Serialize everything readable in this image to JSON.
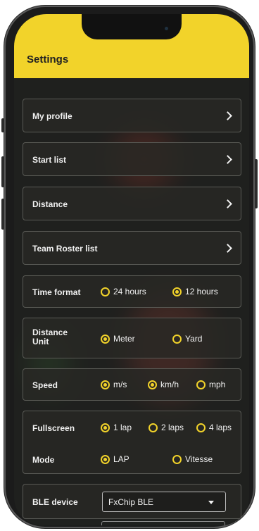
{
  "header": {
    "title": "Settings"
  },
  "nav_items": [
    {
      "label": "My profile"
    },
    {
      "label": "Start list"
    },
    {
      "label": "Distance"
    },
    {
      "label": "Team Roster list"
    }
  ],
  "time_format": {
    "label": "Time format",
    "options": [
      "24 hours",
      "12 hours"
    ],
    "selected": "12 hours"
  },
  "distance_unit": {
    "label": "Distance Unit",
    "options": [
      "Meter",
      "Yard"
    ],
    "selected": "Meter"
  },
  "speed": {
    "label": "Speed",
    "options": [
      "m/s",
      "km/h",
      "mph"
    ],
    "selected": [
      "m/s",
      "km/h"
    ]
  },
  "fullscreen": {
    "label": "Fullscreen",
    "options": [
      "1 lap",
      "2 laps",
      "4 laps"
    ],
    "selected": "1 lap"
  },
  "mode": {
    "label": "Mode",
    "options": [
      "LAP",
      "Vitesse"
    ],
    "selected": "LAP"
  },
  "ble_device": {
    "label": "BLE device",
    "value": "FxChip BLE"
  },
  "colors": {
    "accent": "#f2d32a",
    "background": "#1f201e",
    "card_border": "#595a55",
    "text": "#f1f1f1"
  },
  "icons": {
    "nav_arrow": "chevron-right-icon",
    "dropdown": "chevron-down-icon",
    "radio": "radio-icon"
  }
}
